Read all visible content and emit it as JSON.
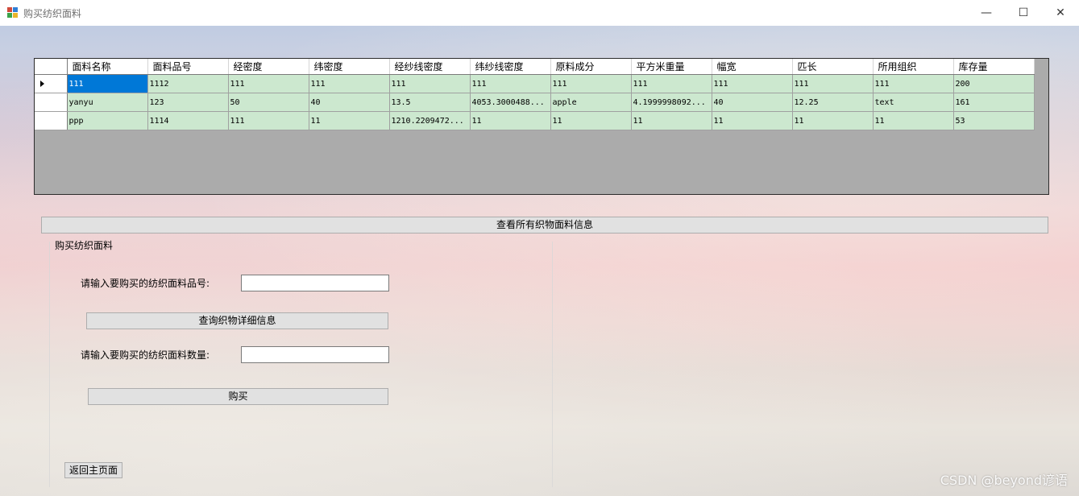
{
  "window": {
    "title": "购买纺织面料"
  },
  "grid": {
    "columns": [
      "面料名称",
      "面料品号",
      "经密度",
      "纬密度",
      "经纱线密度",
      "纬纱线密度",
      "原料成分",
      "平方米重量",
      "幅宽",
      "匹长",
      "所用组织",
      "库存量"
    ],
    "rows": [
      [
        "111",
        "1112",
        "111",
        "111",
        "111",
        "111",
        "111",
        "111",
        "111",
        "111",
        "111",
        "200"
      ],
      [
        "yanyu",
        "123",
        "50",
        "40",
        "13.5",
        "4053.3000488...",
        "apple",
        "4.1999998092...",
        "40",
        "12.25",
        "text",
        "161"
      ],
      [
        "ppp",
        "1114",
        "111",
        "11",
        "1210.2209472...",
        "11",
        "11",
        "11",
        "11",
        "11",
        "11",
        "53"
      ]
    ]
  },
  "buttons": {
    "view_all": "查看所有织物面料信息",
    "query_detail": "查询织物详细信息",
    "buy": "购买",
    "back_home": "返回主页面"
  },
  "group": {
    "title": "购买纺织面料",
    "code_label": "请输入要购买的纺织面料品号:",
    "code_value": "",
    "qty_label": "请输入要购买的纺织面料数量:",
    "qty_value": ""
  },
  "watermark": "CSDN @beyond谚语"
}
